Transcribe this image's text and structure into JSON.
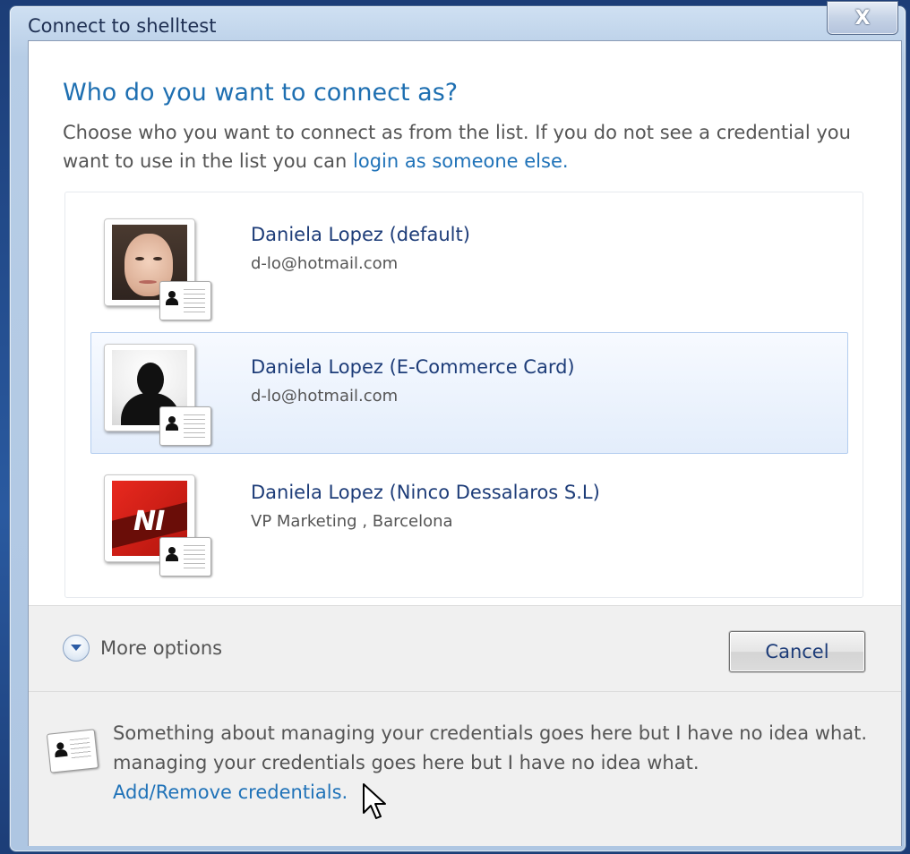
{
  "window": {
    "title": "Connect to shelltest",
    "close_symbol": "X"
  },
  "dialog": {
    "heading": "Who do you want to connect as?",
    "instructions_prefix": "Choose who you want to connect as from the list. If you do not see a credential you want to use in the list you can ",
    "login_link": "login as someone else."
  },
  "credentials": [
    {
      "name": "Daniela Lopez (default)",
      "detail": "d-lo@hotmail.com",
      "icon": "user-photo-icon",
      "selected": false
    },
    {
      "name": "Daniela Lopez (E-Commerce Card)",
      "detail": "d-lo@hotmail.com",
      "icon": "silhouette-icon",
      "selected": true
    },
    {
      "name": "Daniela Lopez (Ninco Dessalaros S.L)",
      "detail": "VP Marketing , Barcelona",
      "icon": "company-logo-icon",
      "logo_text": "NI",
      "selected": false
    }
  ],
  "options": {
    "more_options_label": "More options",
    "cancel_label": "Cancel"
  },
  "info": {
    "line1": "Something about managing your credentials goes here but I have no idea what.",
    "line2": "managing your credentials goes here but I have no idea what.",
    "manage_link": "Add/Remove credentials."
  },
  "colors": {
    "heading": "#1e6fb1",
    "link": "#1f72b8",
    "name_text": "#1d3c78",
    "selection": "#e3edfb"
  }
}
